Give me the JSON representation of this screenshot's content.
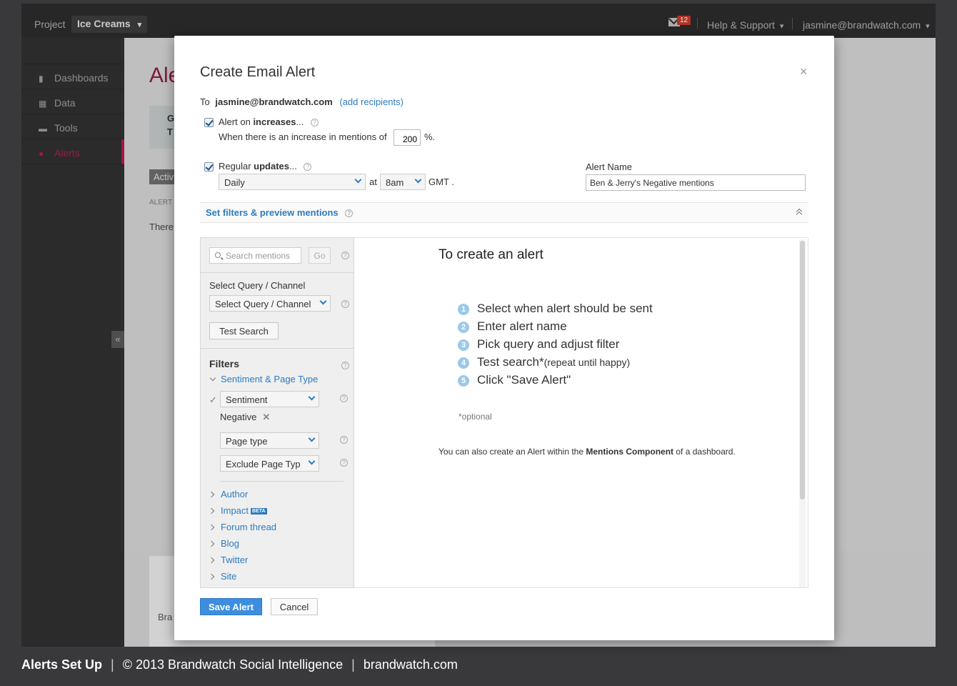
{
  "topbar": {
    "project_label": "Project",
    "project_name": "Ice Creams",
    "notification_count": "12",
    "help_label": "Help & Support",
    "user_email": "jasmine@brandwatch.com"
  },
  "sidebar": {
    "items": [
      {
        "label": "Dashboards",
        "icon": "bar-chart-icon"
      },
      {
        "label": "Data",
        "icon": "grid-icon"
      },
      {
        "label": "Tools",
        "icon": "toolbox-icon"
      },
      {
        "label": "Alerts",
        "icon": "alert-icon"
      }
    ]
  },
  "main": {
    "title_partial": "Ale",
    "box_text_1": "G",
    "box_text_2": "T",
    "active_tab": "Activ",
    "alert_col": "ALERT",
    "there_text": "There",
    "bottom_partial": "Bra"
  },
  "modal": {
    "title": "Create Email Alert",
    "close_icon": "×",
    "to_label": "To",
    "to_email": "jasmine@brandwatch.com",
    "add_recipients": "(add recipients)",
    "alert_on": "Alert on",
    "increases": "increases",
    "ellipsis": "...",
    "increase_desc": "When there is an increase in mentions of",
    "increase_value": "200",
    "percent": "%.",
    "regular": "Regular",
    "updates": "updates",
    "frequency": "Daily",
    "at_label": "at",
    "time": "8am",
    "gmt": "GMT .",
    "alert_name_label": "Alert Name",
    "alert_name_value": "Ben & Jerry's Negative mentions",
    "filters_bar": "Set filters & preview mentions",
    "save_button": "Save Alert",
    "cancel_button": "Cancel"
  },
  "filter_panel": {
    "search_placeholder": "Search mentions",
    "go": "Go",
    "select_query_label": "Select Query / Channel",
    "select_query_value": "Select Query / Channel",
    "test_search": "Test Search",
    "filters_heading": "Filters",
    "sentiment_page_type": "Sentiment & Page Type",
    "checkmark": "✓",
    "sentiment": "Sentiment",
    "negative": "Negative",
    "remove_icon": "✕",
    "page_type": "Page type",
    "exclude_page_type": "Exclude Page Typ",
    "collapsed": [
      {
        "label": "Author"
      },
      {
        "label": "Impact",
        "badge": "BETA"
      },
      {
        "label": "Forum thread"
      },
      {
        "label": "Blog"
      },
      {
        "label": "Twitter"
      },
      {
        "label": "Site"
      }
    ]
  },
  "instructions": {
    "title": "To create an alert",
    "steps": [
      {
        "num": "1",
        "text": "Select when alert should be sent"
      },
      {
        "num": "2",
        "text": "Enter alert name"
      },
      {
        "num": "3",
        "text": "Pick query and adjust filter"
      },
      {
        "num": "4",
        "text": "Test search",
        "asterisk": "*",
        "note": "(repeat until happy)"
      },
      {
        "num": "5",
        "text": "Click \"Save Alert\""
      }
    ],
    "optional": "*optional",
    "note_before": "You can also create an Alert within the",
    "note_bold": "Mentions Component",
    "note_after": "of a dashboard."
  },
  "footer": {
    "title": "Alerts Set Up",
    "copyright": "© 2013 Brandwatch Social Intelligence",
    "site": "brandwatch.com"
  }
}
